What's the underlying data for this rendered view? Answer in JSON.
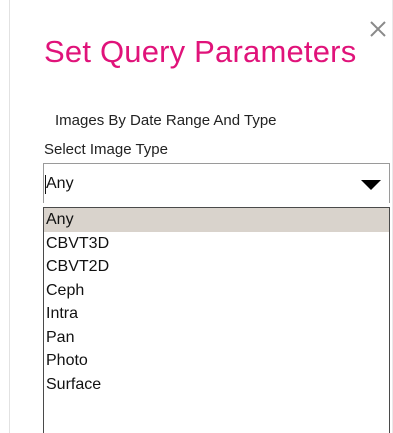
{
  "dialog": {
    "title": "Set Query Parameters",
    "close_icon": "close-icon"
  },
  "filters": {
    "section_label": "Images By Date Range And Type",
    "image_type": {
      "label": "Select Image Type",
      "selected_value": "Any",
      "options": [
        "Any",
        "CBVT3D",
        "CBVT2D",
        "Ceph",
        "Intra",
        "Pan",
        "Photo",
        "Surface"
      ],
      "highlighted_index": 0
    }
  },
  "colors": {
    "title": "#e0137a",
    "highlight": "#d9d3cc"
  }
}
